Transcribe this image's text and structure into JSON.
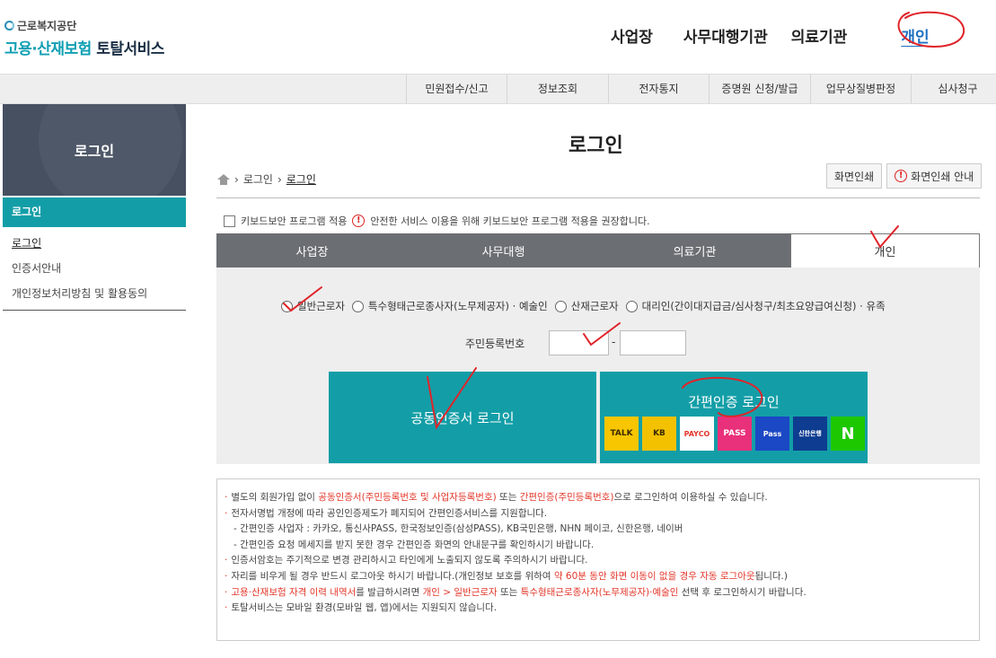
{
  "header": {
    "org_name": "근로복지공단",
    "service_title_part1": "고용·산재보험",
    "service_title_part2": "토탈서비스",
    "nav": [
      "사업장",
      "사무대행기관",
      "의료기관",
      "개인"
    ]
  },
  "gnb": [
    "민원접수/신고",
    "정보조회",
    "전자통지",
    "증명원 신청/발급",
    "업무상질병판정",
    "심사청구"
  ],
  "sidebar": {
    "title": "로그인",
    "active": "로그인",
    "items": [
      "로그인",
      "인증서안내",
      "개인정보처리방침 및 활용동의"
    ]
  },
  "page": {
    "title": "로그인",
    "breadcrumb": [
      "로그인",
      "로그인"
    ],
    "print_button": "화면인쇄",
    "print_guide_button": "화면인쇄 안내"
  },
  "keyboard_security": {
    "label": "키보드보안 프로그램 적용",
    "notice": "안전한 서비스 이용을 위해 키보드보안 프로그램 적용을 권장합니다."
  },
  "tabs": [
    "사업장",
    "사무대행",
    "의료기관",
    "개인"
  ],
  "radio_options": [
    "일반근로자",
    "특수형태근로종사자(노무제공자) · 예술인",
    "산재근로자",
    "대리인(간이대지급금/심사청구/최초요양급여신청) · 유족"
  ],
  "id_field": {
    "label": "주민등록번호",
    "separator": "-"
  },
  "cert_login": "공동인증서 로그인",
  "simple_login": {
    "label": "간편인증 로그인",
    "providers": [
      {
        "name": "카카오톡",
        "text": "TALK",
        "icon": "kakao-icon"
      },
      {
        "name": "KB국민은행",
        "text": "KB",
        "icon": "kb-icon"
      },
      {
        "name": "페이코",
        "text": "PAYCO",
        "icon": "payco-icon"
      },
      {
        "name": "PASS",
        "text": "PASS",
        "icon": "pass-icon"
      },
      {
        "name": "삼성 Pass",
        "text": "Pass",
        "icon": "samsung-pass-icon"
      },
      {
        "name": "신한은행",
        "text": "신한은행",
        "icon": "shinhan-icon"
      },
      {
        "name": "네이버",
        "text": "N",
        "icon": "naver-icon"
      }
    ]
  },
  "notice": {
    "l1a": "별도의 회원가입 없이 ",
    "l1b": "공동인증서(주민등록번호 및 사업자등록번호)",
    "l1c": " 또는 ",
    "l1d": "간편인증(주민등록번호)",
    "l1e": "으로 로그인하여 이용하실 수 있습니다.",
    "l2": "전자서명법 개정에 따라 공인인증제도가 폐지되어 간편인증서비스를 지원합니다.",
    "l3": "- 간편인증 사업자 : 카카오, 통신사PASS, 한국정보인증(삼성PASS), KB국민은행, NHN 페이코, 신한은행, 네이버",
    "l4": "- 간편인증 요청 메세지를 받지 못한 경우 간편인증 화면의 안내문구를 확인하시기 바랍니다.",
    "l5": "인증서암호는 주기적으로 변경 관리하시고 타인에게 노출되지 않도록 주의하시기 바랍니다.",
    "l6a": "자리를 비우게 될 경우 반드시 로그아웃 하시기 바랍니다.(개인정보 보호를 위하여 ",
    "l6b": "약 60분 동안 화면 이동이 없을 경우 자동 로그아웃",
    "l6c": "됩니다.)",
    "l7a": "고용·산재보험 자격 이력 내역서",
    "l7b": "를 발급하시려면 ",
    "l7c": "개인 > 일반근로자",
    "l7d": " 또는 ",
    "l7e": "특수형태근로종사자(노무제공자)·예술인",
    "l7f": " 선택 후 로그인하시기 바랍니다.",
    "l8": "토탈서비스는 모바일 환경(모바일 웹, 앱)에서는 지원되지 않습니다."
  },
  "colors": {
    "accent": "#139ea7",
    "tab_dark": "#6b6e72",
    "notice_red": "#e3372b",
    "annotation_red": "#e0242a"
  }
}
